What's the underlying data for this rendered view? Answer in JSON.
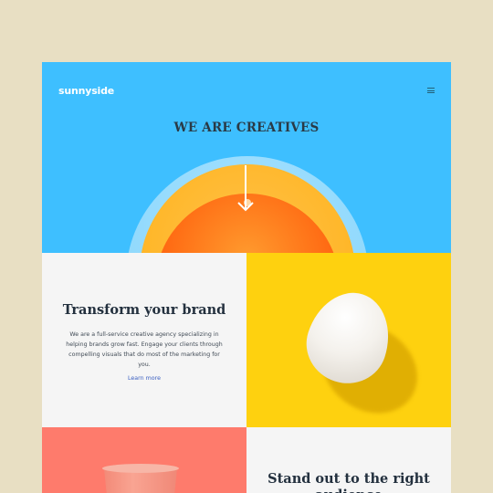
{
  "header": {
    "logo": "sunnyside",
    "menu_icon": "hamburger-menu-icon"
  },
  "hero": {
    "title": "WE ARE CREATIVES",
    "arrow_icon": "arrow-down-icon"
  },
  "features": [
    {
      "title": "Transform your brand",
      "body": "We are a full-service creative agency specializing in helping brands grow fast. Engage your clients through compelling visuals that do most of the marketing for you.",
      "link": "Learn more"
    },
    {
      "title": "Stand out to the right audience"
    }
  ],
  "colors": {
    "background": "#e8dfc3",
    "hero": "#3ebfff",
    "egg_panel": "#fed10f",
    "cup_panel": "#fe7b6c",
    "link": "#3b5fc1"
  }
}
